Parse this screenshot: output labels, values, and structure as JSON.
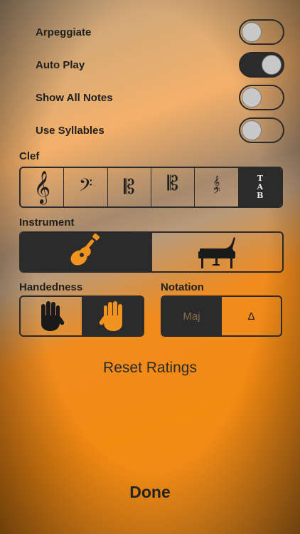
{
  "toggles": [
    {
      "label": "Arpeggiate",
      "state": "off"
    },
    {
      "label": "Auto Play",
      "state": "on"
    },
    {
      "label": "Show All Notes",
      "state": "off"
    },
    {
      "label": "Use Syllables",
      "state": "off"
    }
  ],
  "clef": {
    "label": "Clef",
    "options": [
      "treble-clef",
      "bass-clef",
      "alto-clef",
      "tenor-clef",
      "grand-staff",
      "tab"
    ],
    "tab_letters": [
      "T",
      "A",
      "B"
    ],
    "selected": "tab"
  },
  "instrument": {
    "label": "Instrument",
    "options": [
      "guitar",
      "piano"
    ],
    "selected": "guitar"
  },
  "handedness": {
    "label": "Handedness",
    "options": [
      "left-hand",
      "right-hand"
    ],
    "selected": "right-hand"
  },
  "notation": {
    "label": "Notation",
    "options": [
      "Maj",
      "Δ"
    ],
    "selected": "Maj"
  },
  "reset_label": "Reset Ratings",
  "done_label": "Done",
  "colors": {
    "dark": "#2b2b2b",
    "accent": "#f0921e"
  }
}
